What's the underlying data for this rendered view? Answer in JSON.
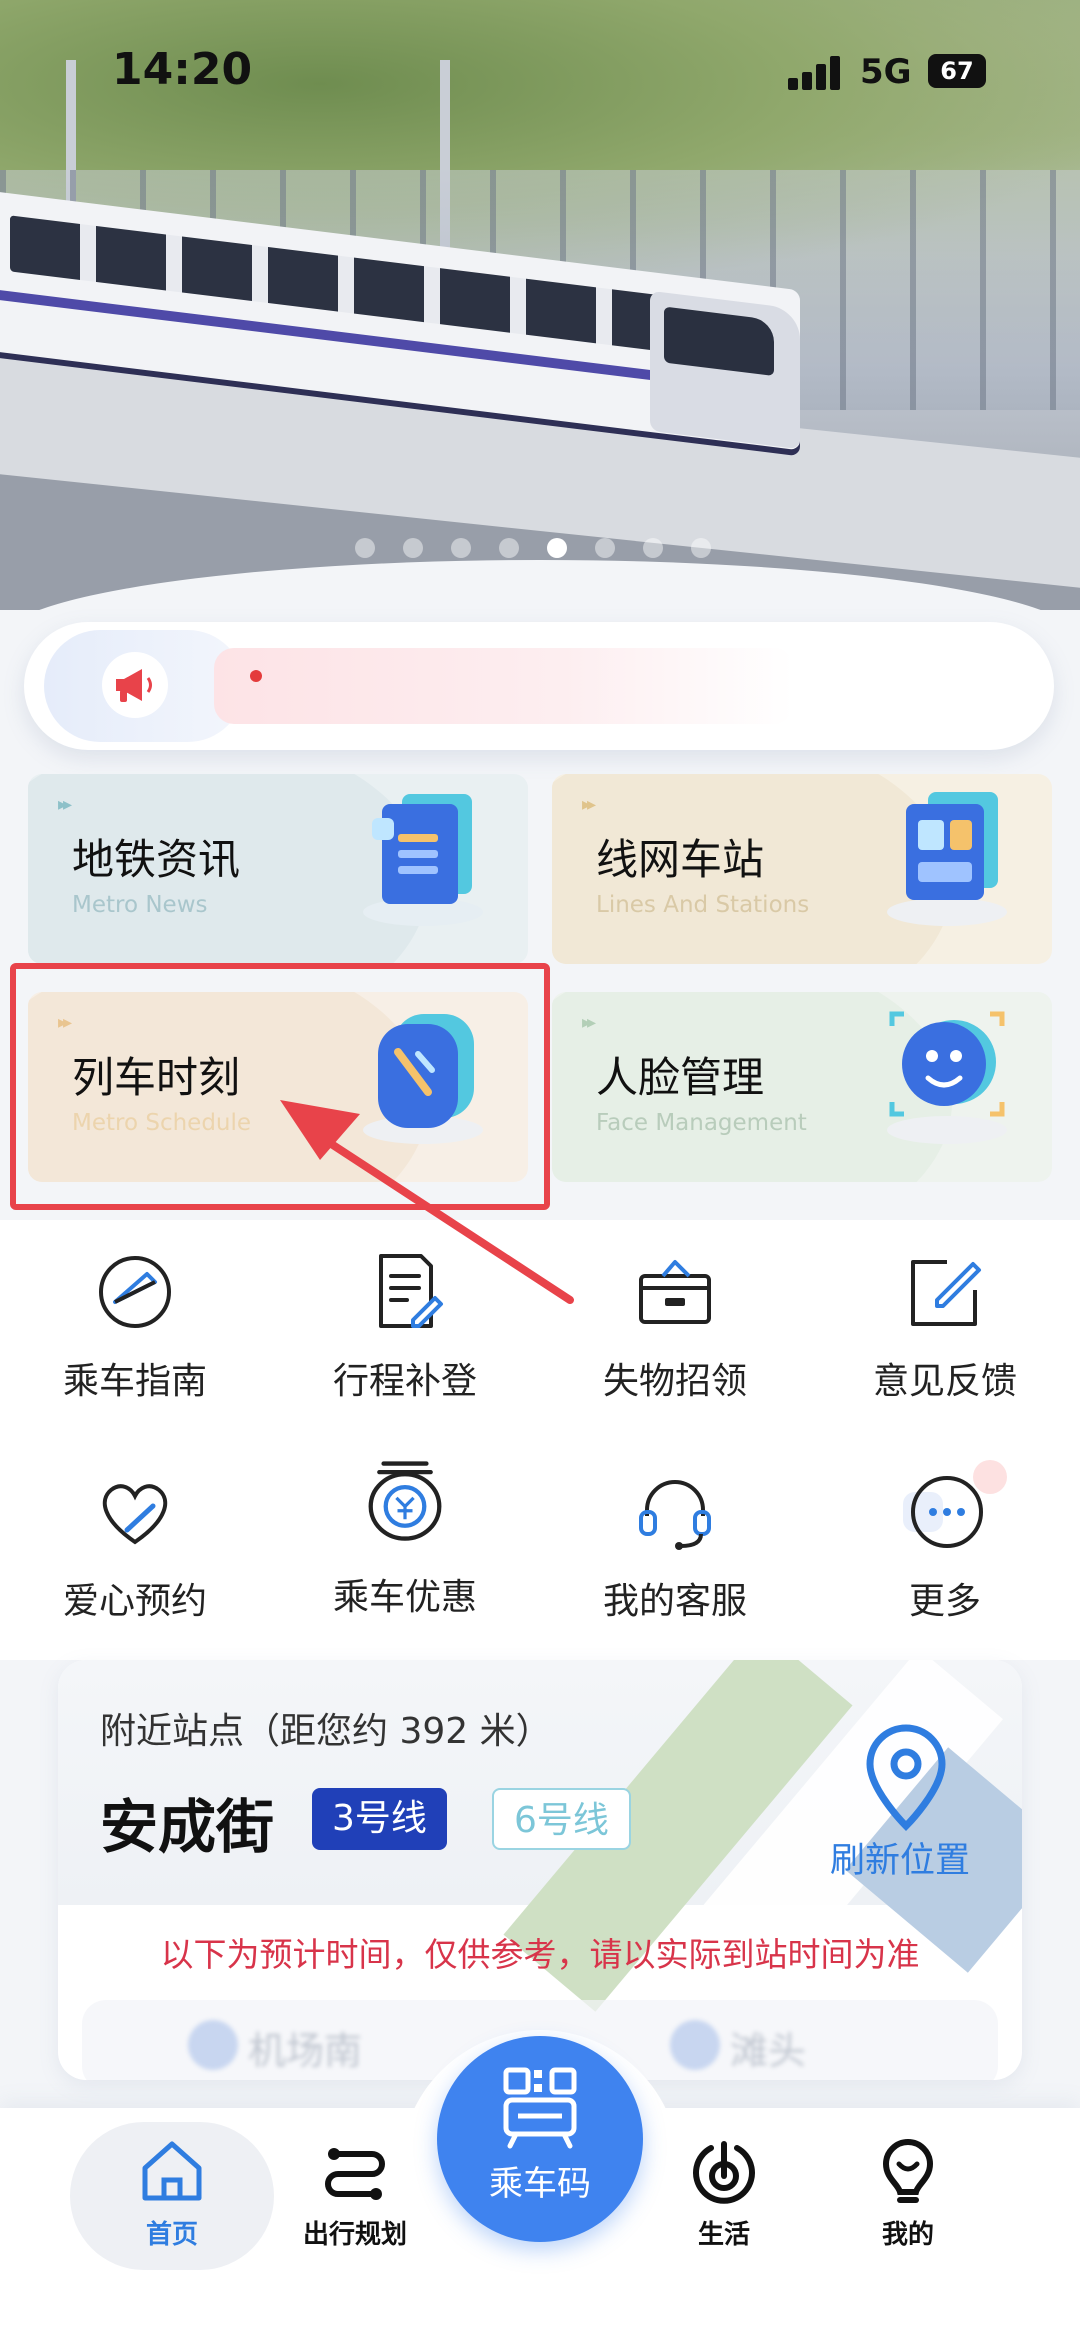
{
  "status_bar": {
    "time": "14:20",
    "network": "5G",
    "battery": "67"
  },
  "banner": {
    "slide_count": 8,
    "active_slide": 5
  },
  "tiles": [
    {
      "title": "地铁资讯",
      "subtitle": "Metro News"
    },
    {
      "title": "线网车站",
      "subtitle": "Lines And Stations"
    },
    {
      "title": "列车时刻",
      "subtitle": "Metro Schedule"
    },
    {
      "title": "人脸管理",
      "subtitle": "Face Management"
    }
  ],
  "quick_menu": [
    {
      "label": "乘车指南",
      "icon": "compass-icon"
    },
    {
      "label": "行程补登",
      "icon": "document-edit-icon"
    },
    {
      "label": "失物招领",
      "icon": "box-icon"
    },
    {
      "label": "意见反馈",
      "icon": "edit-square-icon"
    },
    {
      "label": "爱心预约",
      "icon": "heart-icon"
    },
    {
      "label": "乘车优惠",
      "icon": "yen-coin-icon"
    },
    {
      "label": "我的客服",
      "icon": "headset-icon"
    },
    {
      "label": "更多",
      "icon": "more-dots-icon"
    }
  ],
  "nearby": {
    "title": "附近站点（距您约 392 米）",
    "station": "安成街",
    "lines": [
      "3号线",
      "6号线"
    ],
    "refresh_label": "刷新位置",
    "notice": "以下为预计时间，仅供参考，请以实际到站时间为准",
    "next_stations": [
      "机场南",
      "滩头"
    ]
  },
  "tabbar": {
    "home": "首页",
    "plan": "出行规划",
    "ride_code": "乘车码",
    "life": "生活",
    "mine": "我的"
  },
  "colors": {
    "accent": "#3f83ef",
    "line3": "#2040b8",
    "line6": "#7cc6d8",
    "alert": "#d8344a",
    "highlight": "#e8434a"
  }
}
